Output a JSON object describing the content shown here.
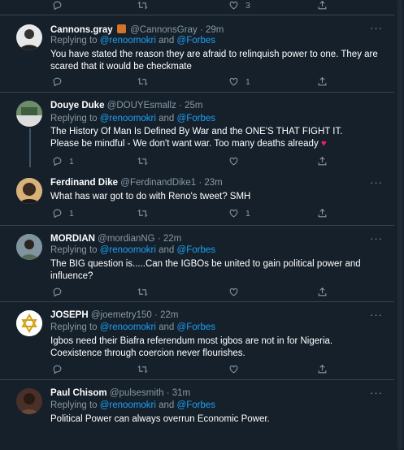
{
  "top_actions": {
    "like_count": "3"
  },
  "tweets": [
    {
      "name": "Cannons.gray",
      "handle": "@CannonsGray",
      "time": "29m",
      "replying_prefix": "Replying to ",
      "mention1": "@renoomokri",
      "and": " and ",
      "mention2": "@Forbes",
      "text_line1": "You have stated the reason they are afraid to relinquish power to one. They are",
      "text_line2": "scared that it would be checkmate",
      "reply_count": "",
      "like_count": "1"
    },
    {
      "name": "Douye Duke",
      "handle": "@DOUYEsmallz",
      "time": "25m",
      "replying_prefix": "Replying to ",
      "mention1": "@renoomokri",
      "and": " and ",
      "mention2": "@Forbes",
      "text_line1": "The History Of Man Is Defined By War and the ONE'S THAT FIGHT IT.",
      "text_line2": "Please be mindful - We don't want war. Too many deaths already",
      "reply_count": "1",
      "like_count": ""
    },
    {
      "name": "Ferdinand Dike",
      "handle": "@FerdinandDike1",
      "time": "23m",
      "text_line1": "What has war got to do with Reno's tweet? SMH",
      "reply_count": "1",
      "like_count": "1"
    },
    {
      "name": "MORDIAN",
      "handle": "@mordianNG",
      "time": "22m",
      "replying_prefix": "Replying to ",
      "mention1": "@renoomokri",
      "and": " and ",
      "mention2": "@Forbes",
      "text_line1": "The BIG question is.....Can the IGBOs be united to gain political power and",
      "text_line2": "influence?",
      "reply_count": "",
      "like_count": ""
    },
    {
      "name": "JOSEPH",
      "handle": "@joemetry150",
      "time": "22m",
      "replying_prefix": "Replying to ",
      "mention1": "@renoomokri",
      "and": " and ",
      "mention2": "@Forbes",
      "text_line1": "Igbos need their Biafra referendum most igbos are not in for Nigeria.",
      "text_line2": "Coexistence through coercion never flourishes.",
      "reply_count": "",
      "like_count": ""
    },
    {
      "name": "Paul Chisom",
      "handle": "@pulsesmith",
      "time": "31m",
      "replying_prefix": "Replying to ",
      "mention1": "@renoomokri",
      "and": " and ",
      "mention2": "@Forbes",
      "text_line1": "Political Power can always overrun Economic Power."
    }
  ],
  "colors": {
    "background": "#15202b",
    "divider": "#38444d",
    "secondary_text": "#8899a6",
    "accent": "#1da1f2",
    "heart": "#e0245e"
  },
  "icons": [
    "reply-icon",
    "retweet-icon",
    "like-icon",
    "share-icon",
    "more-icon",
    "broken-heart-icon"
  ]
}
